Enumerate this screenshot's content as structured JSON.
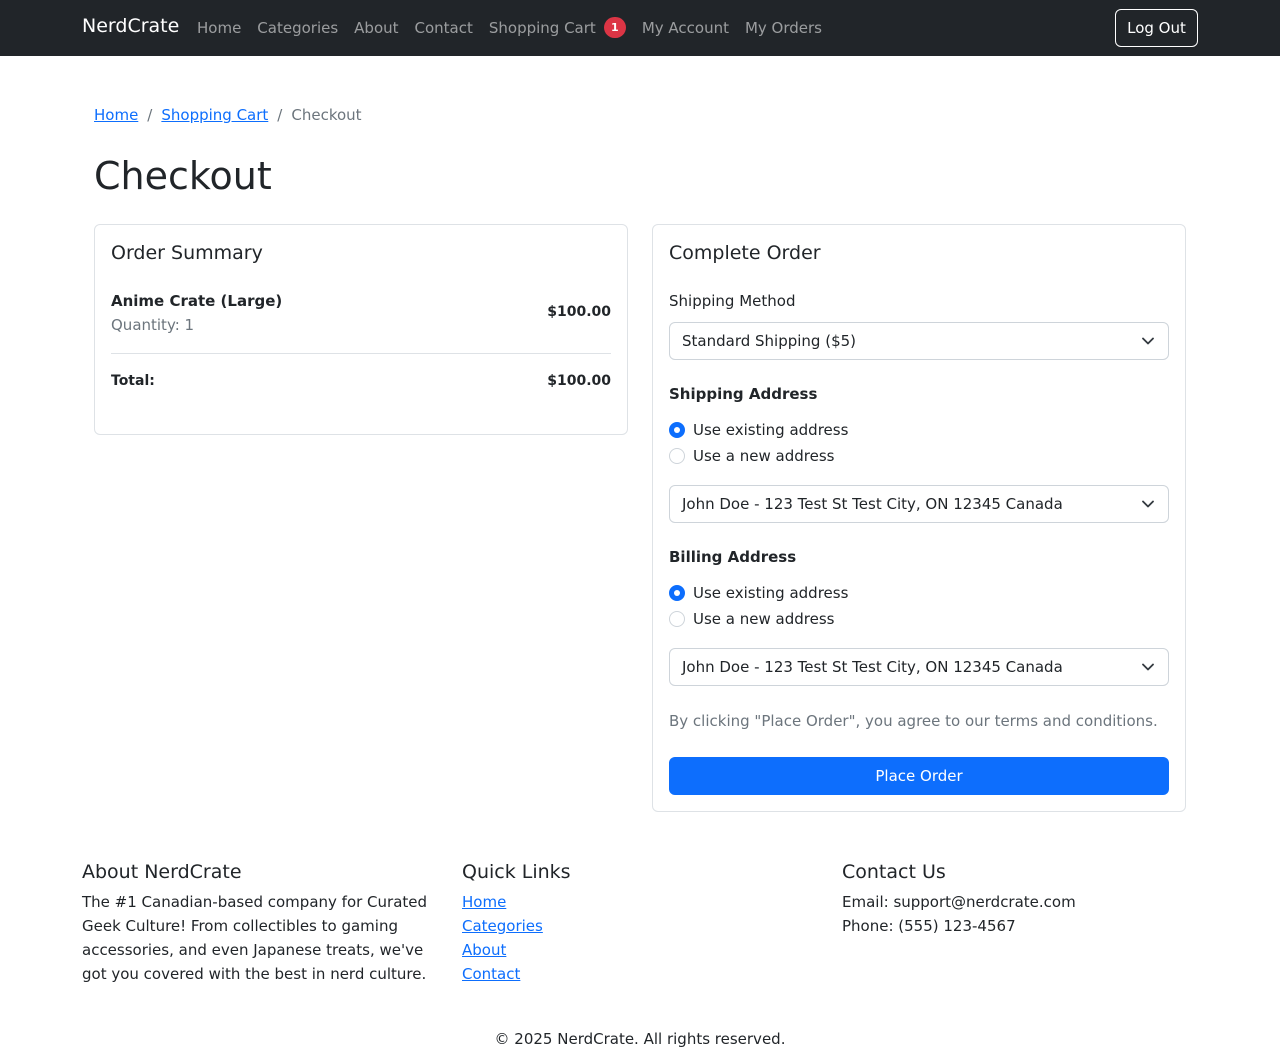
{
  "nav": {
    "brand": "NerdCrate",
    "links": [
      "Home",
      "Categories",
      "About",
      "Contact",
      "Shopping Cart",
      "My Account",
      "My Orders"
    ],
    "cart_badge": "1",
    "logout": "Log Out"
  },
  "breadcrumb": {
    "home": "Home",
    "cart": "Shopping Cart",
    "separator": "/",
    "current": "Checkout"
  },
  "page_title": "Checkout",
  "summary": {
    "title": "Order Summary",
    "item_name": "Anime Crate (Large)",
    "item_qty": "Quantity: 1",
    "item_price": "$100.00",
    "total_label": "Total:",
    "total_value": "$100.00"
  },
  "order": {
    "title": "Complete Order",
    "shipping_method_label": "Shipping Method",
    "shipping_method_value": "Standard Shipping ($5)",
    "shipping_address_label": "Shipping Address",
    "billing_address_label": "Billing Address",
    "radio_existing": "Use existing address",
    "radio_new": "Use a new address",
    "shipping_address_value": "John Doe - 123 Test St Test City, ON 12345 Canada",
    "billing_address_value": "John Doe - 123 Test St Test City, ON 12345 Canada",
    "terms": "By clicking \"Place Order\", you agree to our terms and conditions.",
    "place_order": "Place Order"
  },
  "footer": {
    "about_title": "About NerdCrate",
    "about_text": "The #1 Canadian-based company for Curated Geek Culture! From collectibles to gaming accessories, and even Japanese treats, we've got you covered with the best in nerd culture.",
    "links_title": "Quick Links",
    "links": [
      "Home",
      "Categories",
      "About",
      "Contact"
    ],
    "contact_title": "Contact Us",
    "email": "Email: support@nerdcrate.com",
    "phone": "Phone: (555) 123-4567",
    "copyright": "© 2025 NerdCrate. All rights reserved."
  },
  "colors": {
    "navbar": "#212529",
    "primary": "#0d6efd",
    "badge": "#dc3545",
    "muted": "#6c757d",
    "border": "#dee2e6"
  }
}
